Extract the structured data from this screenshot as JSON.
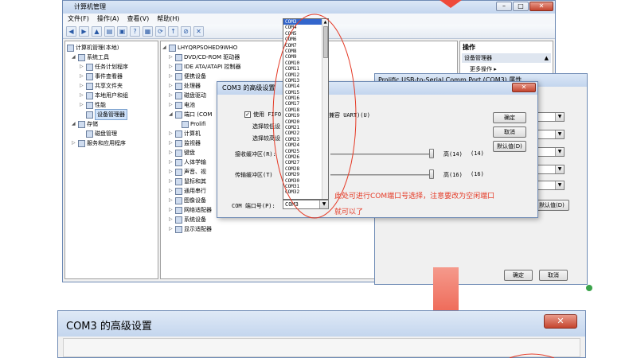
{
  "main_window": {
    "title": "计算机管理",
    "menu": [
      "文件(F)",
      "操作(A)",
      "查看(V)",
      "帮助(H)"
    ],
    "tree": [
      "计算机管理(本地)",
      "系统工具",
      "任务计划程序",
      "事件查看器",
      "共享文件夹",
      "本地用户和组",
      "性能",
      "设备管理器",
      "存储",
      "磁盘管理",
      "服务和应用程序"
    ],
    "devices": {
      "computer": "LHYQRPSOHED9WHO",
      "items": [
        "DVD/CD-ROM 驱动器",
        "IDE ATA/ATAPI 控制器",
        "便携设备",
        "处理器",
        "磁盘驱动",
        "端口 (COM",
        "Prolifi",
        "计算机",
        "监视器",
        "键盘",
        "人体学输",
        "声音、视",
        "鼠标和其",
        "通用串行",
        "图像设备",
        "网络适配器",
        "系统设备",
        "显示适配器"
      ],
      "battery": "电池"
    },
    "actions": {
      "header": "操作",
      "device_manager": "设备管理器",
      "more": "更多操作"
    }
  },
  "props_window": {
    "title": "Prolific USB-to-Serial Comm Port (COM3) 属性",
    "buttons": {
      "advanced": "默认值(D)",
      "ok": "确定",
      "cancel": "取消"
    }
  },
  "adv_dialog": {
    "title": "COM3 的高级设置",
    "use_fifo": "使用 FIFO",
    "fifo_tail": "兼容 UART)(U)",
    "rx_low": "选择较低设",
    "rx_high": "选择较高设",
    "rx_label": "接收缓冲区(R):",
    "tx_label": "传输缓冲区(T)",
    "rx_high_text": "高(14)",
    "rx_value": "(14)",
    "tx_high_text": "高(16)",
    "tx_value": "(16)",
    "com_label": "COM 端口号(P):",
    "com_value": "COM3",
    "ok": "确定",
    "cancel": "取消",
    "defaults": "默认值(D)",
    "slider_rx_level": 1.0,
    "slider_tx_level": 1.0
  },
  "com_list": {
    "items": [
      "COM3",
      "COM4",
      "COM5",
      "COM6",
      "COM7",
      "COM8",
      "COM9",
      "COM10",
      "COM11",
      "COM12",
      "COM13",
      "COM14",
      "COM15",
      "COM16",
      "COM17",
      "COM18",
      "COM19",
      "COM20",
      "COM21",
      "COM22",
      "COM23",
      "COM24",
      "COM25",
      "COM26",
      "COM27",
      "COM28",
      "COM29",
      "COM30",
      "COM31",
      "COM32"
    ],
    "selected": "COM3"
  },
  "annotation": {
    "line1": "此处可进行COM端口号选择，注意要改为空闲端口",
    "line2": "就可以了"
  },
  "lower_dialog": {
    "title": "COM3 的高级设置"
  },
  "colors": {
    "annotation": "#e53a26",
    "arrow": "#ef4a3a",
    "selection": "#3366cc"
  }
}
